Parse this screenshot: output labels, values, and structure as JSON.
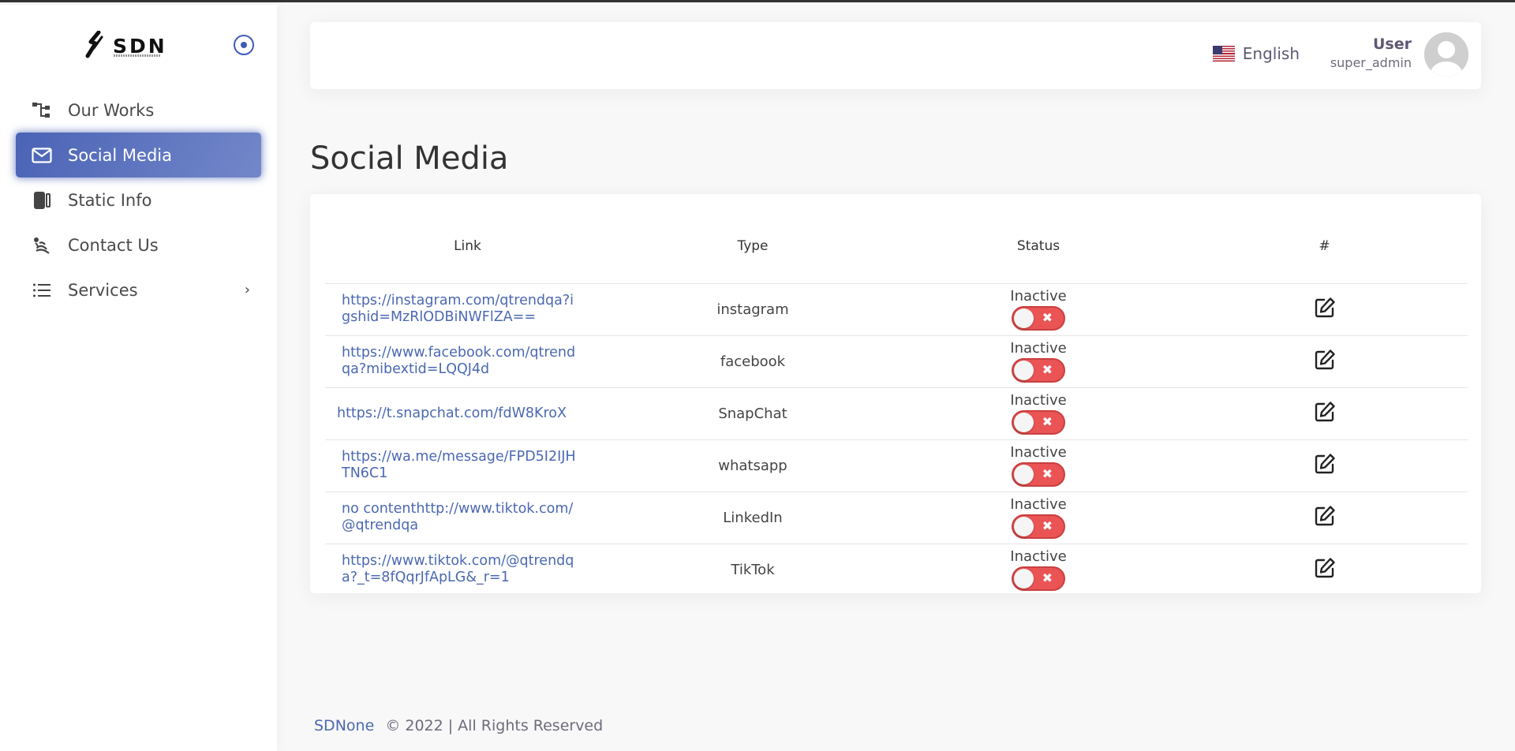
{
  "brand": {
    "name": "SDN"
  },
  "sidebar": {
    "items": [
      {
        "label": "Our Works",
        "icon": "sitemap-icon"
      },
      {
        "label": "Social Media",
        "icon": "mail-icon",
        "active": true
      },
      {
        "label": "Static Info",
        "icon": "info-panel-icon"
      },
      {
        "label": "Contact Us",
        "icon": "signal-icon"
      },
      {
        "label": "Services",
        "icon": "list-icon",
        "has_children": true
      }
    ]
  },
  "header": {
    "language": "English",
    "user_name": "User",
    "user_role": "super_admin"
  },
  "page": {
    "title": "Social Media"
  },
  "table": {
    "columns": [
      "Link",
      "Type",
      "Status",
      "#"
    ],
    "rows": [
      {
        "link": "https://instagram.com/qtrendqa?igshid=MzRlODBiNWFlZA==",
        "type": "instagram",
        "status": "Inactive"
      },
      {
        "link": "https://www.facebook.com/qtrendqa?mibextid=LQQJ4d",
        "type": "facebook",
        "status": "Inactive"
      },
      {
        "link": "https://t.snapchat.com/fdW8KroX",
        "type": "SnapChat",
        "status": "Inactive"
      },
      {
        "link": "https://wa.me/message/FPD5I2IJHTN6C1",
        "type": "whatsapp",
        "status": "Inactive"
      },
      {
        "link": "no contenthttp://www.tiktok.com/@qtrendqa",
        "type": "LinkedIn",
        "status": "Inactive"
      },
      {
        "link": "https://www.tiktok.com/@qtrendqa?_t=8fQqrJfApLG&_r=1",
        "type": "TikTok",
        "status": "Inactive"
      }
    ]
  },
  "footer": {
    "brand": "SDNone",
    "copyright": "© 2022 | All Rights Reserved"
  },
  "colors": {
    "primary": "#4b68b2",
    "danger": "#ea5455"
  }
}
